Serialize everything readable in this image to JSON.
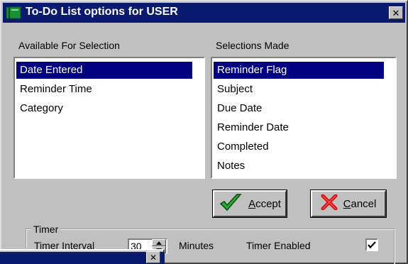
{
  "window": {
    "title": "To-Do List options for USER",
    "close_glyph": "✕",
    "icon": "green-notebook-icon",
    "titlebar_color": "#0a1a70"
  },
  "available": {
    "label": "Available For Selection",
    "items": [
      "Date Entered",
      "Reminder Time",
      "Category"
    ],
    "selected_index": 0
  },
  "selections": {
    "label": "Selections Made",
    "items": [
      "Reminder Flag",
      "Subject",
      "Due Date",
      "Reminder Date",
      "Completed",
      "Notes"
    ],
    "selected_index": 0
  },
  "buttons": {
    "accept": {
      "prefix": "",
      "hotkey": "A",
      "rest": "ccept",
      "icon": "green-checkmark-icon"
    },
    "cancel": {
      "prefix": "",
      "hotkey": "C",
      "rest": "ancel",
      "icon": "red-x-icon"
    }
  },
  "timer": {
    "group_label": "Timer",
    "interval_label": "Timer Interval",
    "interval_value": "30",
    "units_label": "Minutes",
    "enabled_label": "Timer Enabled",
    "enabled": true
  },
  "overlay_window": {
    "close_glyph": "✕"
  }
}
